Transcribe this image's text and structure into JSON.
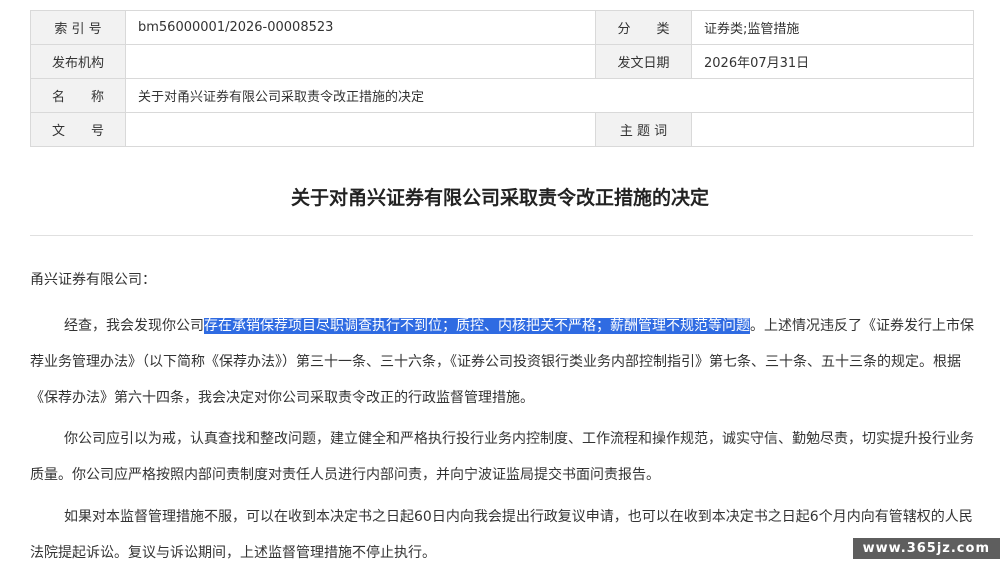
{
  "meta": {
    "index_label": "索 引 号",
    "index_value": "bm56000001/2026-00008523",
    "category_label": "分　　类",
    "category_value": "证券类;监管措施",
    "issuer_label": "发布机构",
    "issuer_value": "",
    "date_label": "发文日期",
    "date_value": "2026年07月31日",
    "name_label": "名　　称",
    "name_value": "关于对甬兴证券有限公司采取责令改正措施的决定",
    "docno_label": "文　　号",
    "docno_value": "",
    "keywords_label": "主 题 词",
    "keywords_value": ""
  },
  "document": {
    "title": "关于对甬兴证券有限公司采取责令改正措施的决定",
    "salutation": "甬兴证券有限公司：",
    "para1_before": "经查，我会发现你公司",
    "para1_highlight": "存在承销保荐项目尽职调查执行不到位；质控、内核把关不严格；薪酬管理不规范等问题",
    "para1_after": "。上述情况违反了《证券发行上市保荐业务管理办法》（以下简称《保荐办法》）第三十一条、三十六条，《证券公司投资银行类业务内部控制指引》第七条、三十条、五十三条的规定。根据《保荐办法》第六十四条，我会决定对你公司采取责令改正的行政监督管理措施。",
    "para2": "你公司应引以为戒，认真查找和整改问题，建立健全和严格执行投行业务内控制度、工作流程和操作规范，诚实守信、勤勉尽责，切实提升投行业务质量。你公司应严格按照内部问责制度对责任人员进行内部问责，并向宁波证监局提交书面问责报告。",
    "para3": "如果对本监督管理措施不服，可以在收到本决定书之日起60日内向我会提出行政复议申请，也可以在收到本决定书之日起6个月内向有管辖权的人民法院提起诉讼。复议与诉讼期间，上述监督管理措施不停止执行。"
  },
  "watermark": "www.365jz.com",
  "colors": {
    "highlight": "#2f6be2",
    "label_bg": "#f2f2f2",
    "border": "#d9d9d9"
  }
}
